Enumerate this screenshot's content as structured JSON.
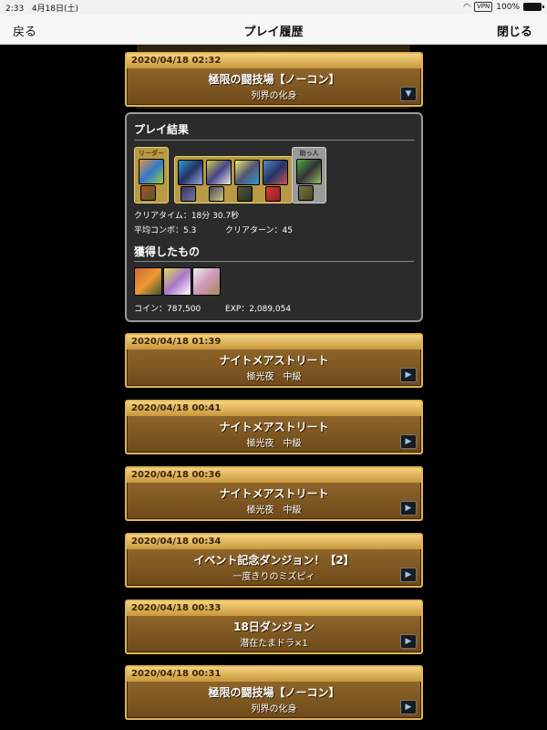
{
  "status_bar": {
    "time": "2:33",
    "date": "4月18日(土)",
    "vpn": "VPN",
    "battery": "100%"
  },
  "nav": {
    "back_label": "戻る",
    "title": "プレイ履歴",
    "close_label": "閉じる"
  },
  "entries": [
    {
      "timestamp": "2020/04/18 02:32",
      "title": "極限の闘技場【ノーコン】",
      "subtitle": "列界の化身",
      "expanded": true
    },
    {
      "timestamp": "2020/04/18 01:39",
      "title": "ナイトメアストリート",
      "subtitle": "極光夜　中級"
    },
    {
      "timestamp": "2020/04/18 00:41",
      "title": "ナイトメアストリート",
      "subtitle": "極光夜　中級"
    },
    {
      "timestamp": "2020/04/18 00:36",
      "title": "ナイトメアストリート",
      "subtitle": "極光夜　中級"
    },
    {
      "timestamp": "2020/04/18 00:34",
      "title": "イベント記念ダンジョン！【2】",
      "subtitle": "一度きりのミズピィ"
    },
    {
      "timestamp": "2020/04/18 00:33",
      "title": "18日ダンジョン",
      "subtitle": "潜在たまドラ×1"
    },
    {
      "timestamp": "2020/04/18 00:31",
      "title": "極限の闘技場【ノーコン】",
      "subtitle": "列界の化身"
    }
  ],
  "result": {
    "section_title": "プレイ結果",
    "leader_label": "リーダー",
    "helper_label": "助っ人",
    "clear_time": "クリアタイム：18分 30.7秒",
    "avg_combo": "平均コンボ：5.3",
    "clear_turn": "クリアターン：45",
    "obtained_title": "獲得したもの",
    "coin": "コイン：787,500",
    "exp": "EXP：2,089,054"
  },
  "colors": {
    "card_border": "#e0b456",
    "card_fill": "#7d5622",
    "header_fill": "#e5bb62",
    "panel_bg": "#2b2b2b",
    "arrow_icon": "#8fc6ff"
  }
}
